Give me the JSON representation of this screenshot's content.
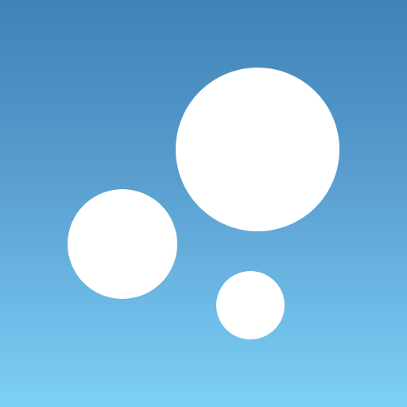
{
  "icon": {
    "name": "bubbles-app-icon",
    "description_visible": "",
    "colors": {
      "background_top": "#3f82b8",
      "background_middle": "#5a9fd0",
      "background_bottom": "#7dd0f7",
      "bubble": "#ffffff"
    },
    "bubbles": [
      {
        "name": "large-bubble-icon"
      },
      {
        "name": "medium-bubble-icon"
      },
      {
        "name": "small-bubble-icon"
      }
    ]
  }
}
